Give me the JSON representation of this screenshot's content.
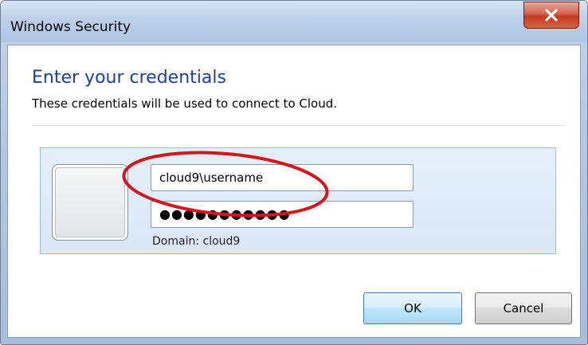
{
  "window": {
    "title": "Windows Security"
  },
  "dialog": {
    "heading": "Enter your credentials",
    "description": "These credentials will be used to connect to Cloud."
  },
  "credentials": {
    "username_value": "cloud9\\username",
    "password_value": "●●●●●●●●●●●",
    "domain_text": "Domain: cloud9"
  },
  "buttons": {
    "ok_label": "OK",
    "cancel_label": "Cancel"
  },
  "icons": {
    "close": "close-icon"
  },
  "colors": {
    "heading": "#1e3f9a",
    "close_button": "#c23b21",
    "annotation": "#d4161c",
    "ok_button_border": "#3c7fb1"
  }
}
